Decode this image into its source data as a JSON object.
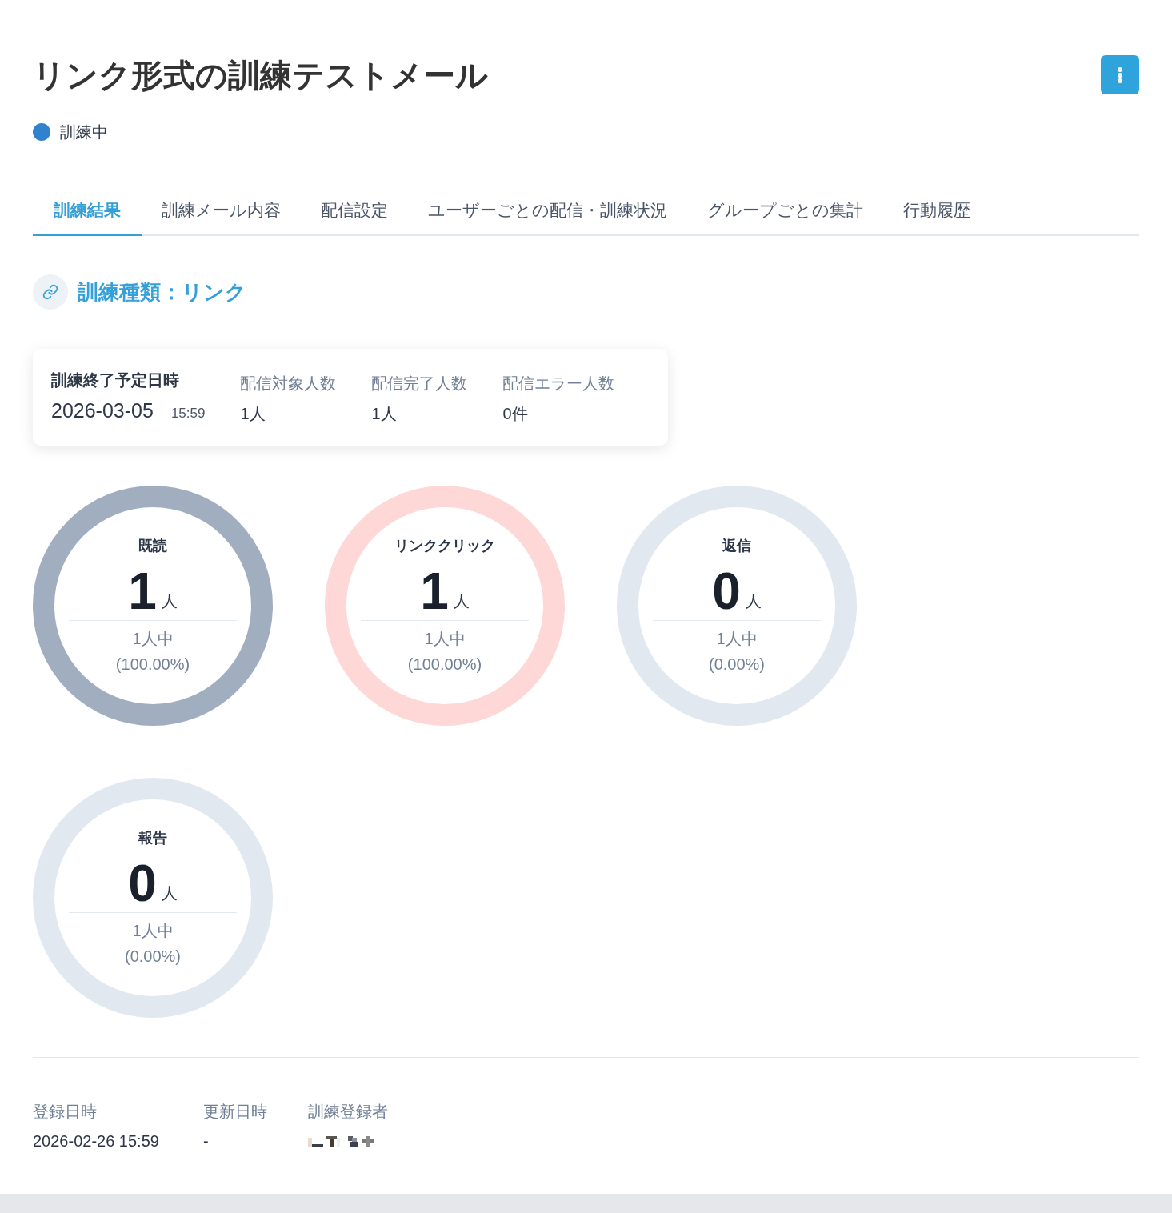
{
  "header": {
    "title": "リンク形式の訓練テストメール",
    "status": {
      "label": "訓練中"
    }
  },
  "tabs": [
    {
      "label": "訓練結果",
      "selected": true
    },
    {
      "label": "訓練メール内容",
      "selected": false
    },
    {
      "label": "配信設定",
      "selected": false
    },
    {
      "label": "ユーザーごとの配信・訓練状況",
      "selected": false
    },
    {
      "label": "グループごとの集計",
      "selected": false
    },
    {
      "label": "行動履歴",
      "selected": false
    }
  ],
  "section": {
    "title": "訓練種類：リンク"
  },
  "summary": {
    "end": {
      "label": "訓練終了予定日時",
      "date": "2026-03-05",
      "time": "15:59"
    },
    "fields": [
      {
        "label": "配信対象人数",
        "value": "1人"
      },
      {
        "label": "配信完了人数",
        "value": "1人"
      },
      {
        "label": "配信エラー人数",
        "value": "0件"
      }
    ]
  },
  "stats": [
    {
      "label": "既読",
      "count": "1",
      "unit": "人",
      "total": "1人中",
      "percent": "(100.00%)",
      "color": "#a0aec0"
    },
    {
      "label": "リンククリック",
      "count": "1",
      "unit": "人",
      "total": "1人中",
      "percent": "(100.00%)",
      "color": "#fed7d7"
    },
    {
      "label": "返信",
      "count": "0",
      "unit": "人",
      "total": "1人中",
      "percent": "(0.00%)",
      "color": "#e2e8f0"
    },
    {
      "label": "報告",
      "count": "0",
      "unit": "人",
      "total": "1人中",
      "percent": "(0.00%)",
      "color": "#e2e8f0"
    }
  ],
  "footer": {
    "fields": [
      {
        "kind": "text",
        "label": "登録日時",
        "value": "2026-02-26 15:59"
      },
      {
        "kind": "text",
        "label": "更新日時",
        "value": "-"
      },
      {
        "kind": "redacted",
        "label": "訓練登録者"
      }
    ]
  }
}
